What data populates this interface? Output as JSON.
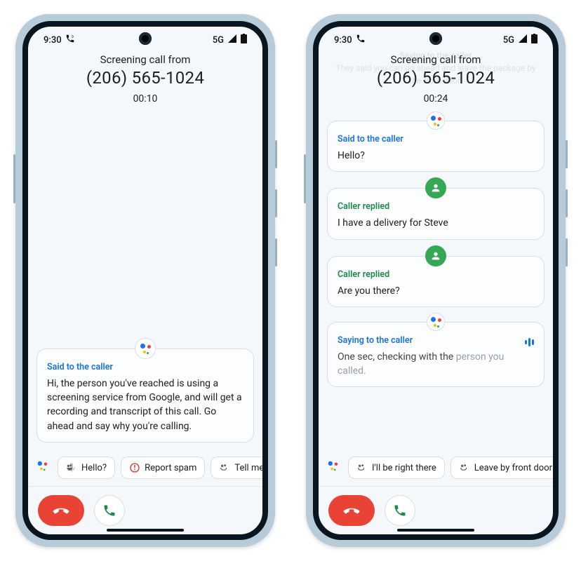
{
  "status": {
    "time": "9:30",
    "network": "5G"
  },
  "phone1": {
    "header": {
      "title": "Screening call from",
      "number": "(206) 565-1024",
      "timer": "00:10"
    },
    "card": {
      "label": "Said to the caller",
      "body": "Hi, the person you've reached is using a screening service from Google, and will get a recording and transcript of this call. Go ahead and say why you're calling."
    },
    "chips": {
      "hello": "Hello?",
      "report_spam": "Report spam",
      "tell_me_more": "Tell me mo"
    }
  },
  "phone2": {
    "header": {
      "title": "Screening call from",
      "number": "(206) 565-1024",
      "timer": "00:24"
    },
    "ghost": {
      "line1": "Saying to the caller",
      "line2": "They said you can go ahead and leave the package by the front door."
    },
    "cards": {
      "said1": {
        "label": "Said to the caller",
        "body": "Hello?"
      },
      "reply1": {
        "label": "Caller replied",
        "body": "I have a delivery for Steve"
      },
      "reply2": {
        "label": "Caller replied",
        "body": "Are you there?"
      },
      "saying": {
        "label": "Saying to the caller",
        "body_pre": "One sec, checking with the ",
        "body_fade": "person you called."
      }
    },
    "chips": {
      "right_there": "I'll be right there",
      "leave_door": "Leave by front door"
    }
  }
}
